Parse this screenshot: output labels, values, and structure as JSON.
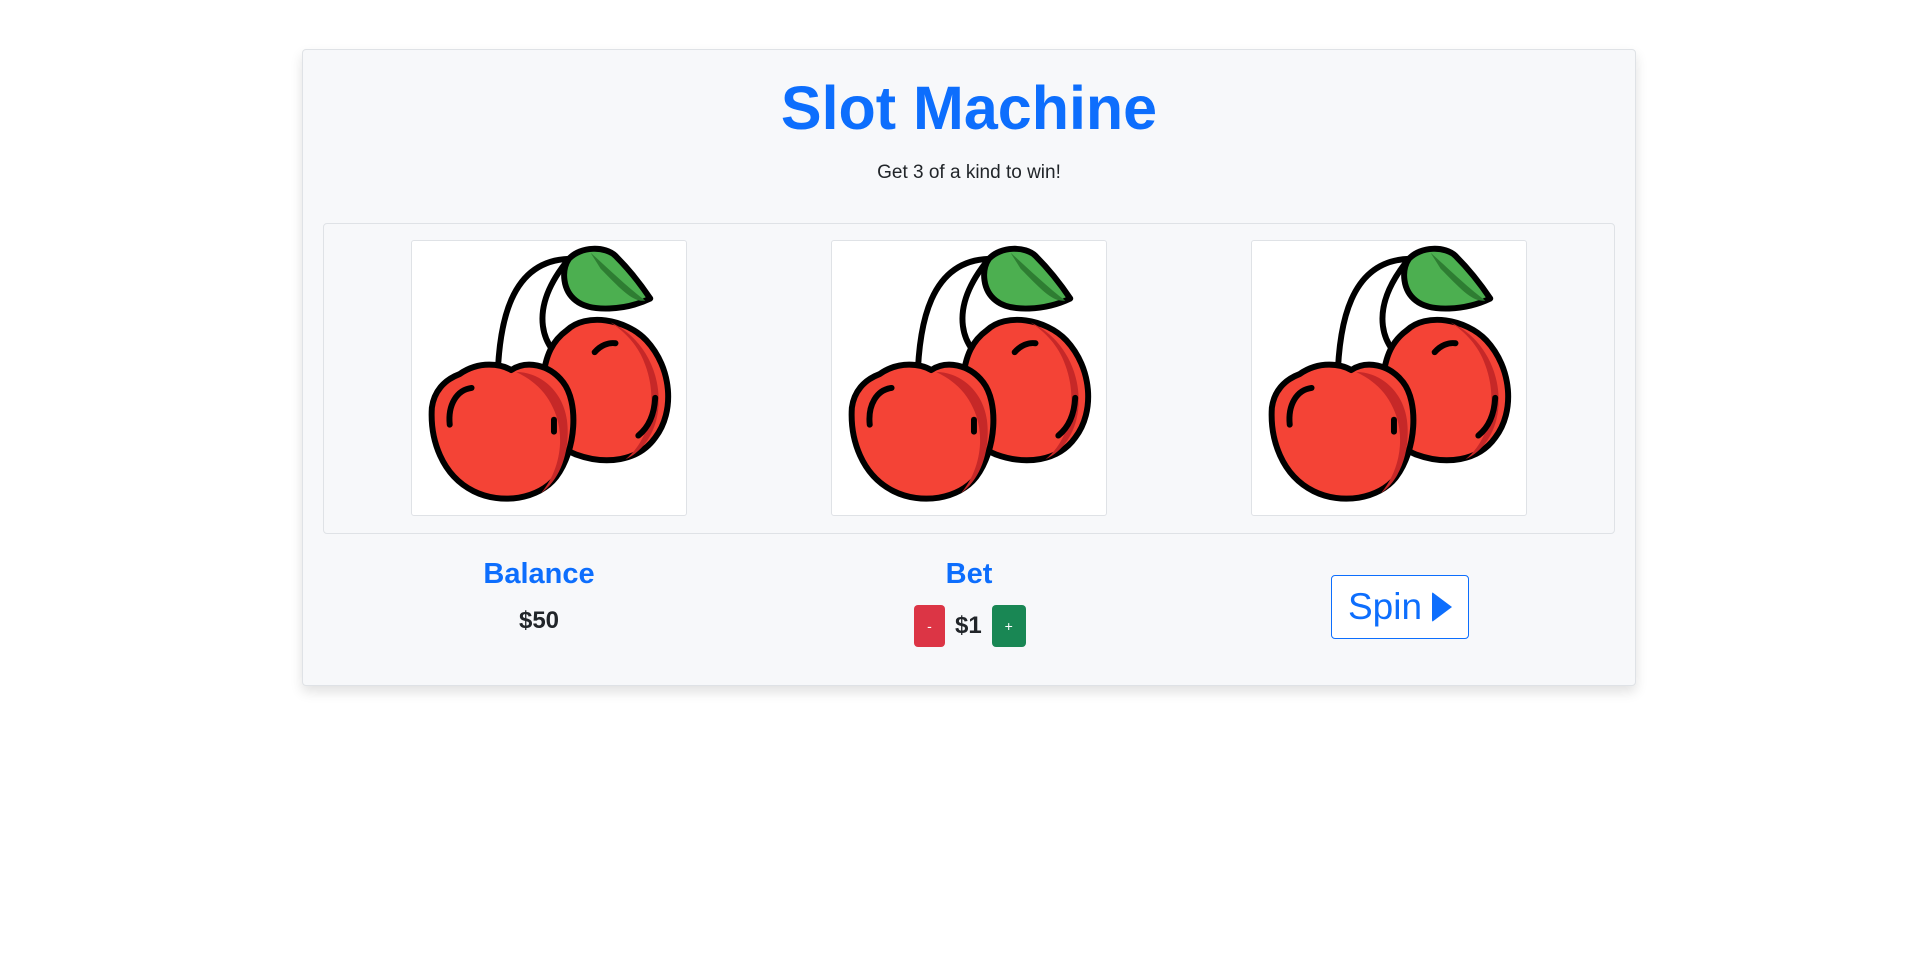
{
  "header": {
    "title": "Slot Machine",
    "subtitle": "Get 3 of a kind to win!"
  },
  "reels": [
    {
      "symbol": "cherries-icon"
    },
    {
      "symbol": "cherries-icon"
    },
    {
      "symbol": "cherries-icon"
    }
  ],
  "balance": {
    "label": "Balance",
    "value": "$50"
  },
  "bet": {
    "label": "Bet",
    "decrease_label": "-",
    "value": "$1",
    "increase_label": "+"
  },
  "spin": {
    "label": "Spin",
    "icon": "play-icon"
  },
  "colors": {
    "accent": "#0d6efd",
    "decrease": "#dc3545",
    "increase": "#198754",
    "cherry": "#f44336",
    "leaf": "#4caf50"
  }
}
